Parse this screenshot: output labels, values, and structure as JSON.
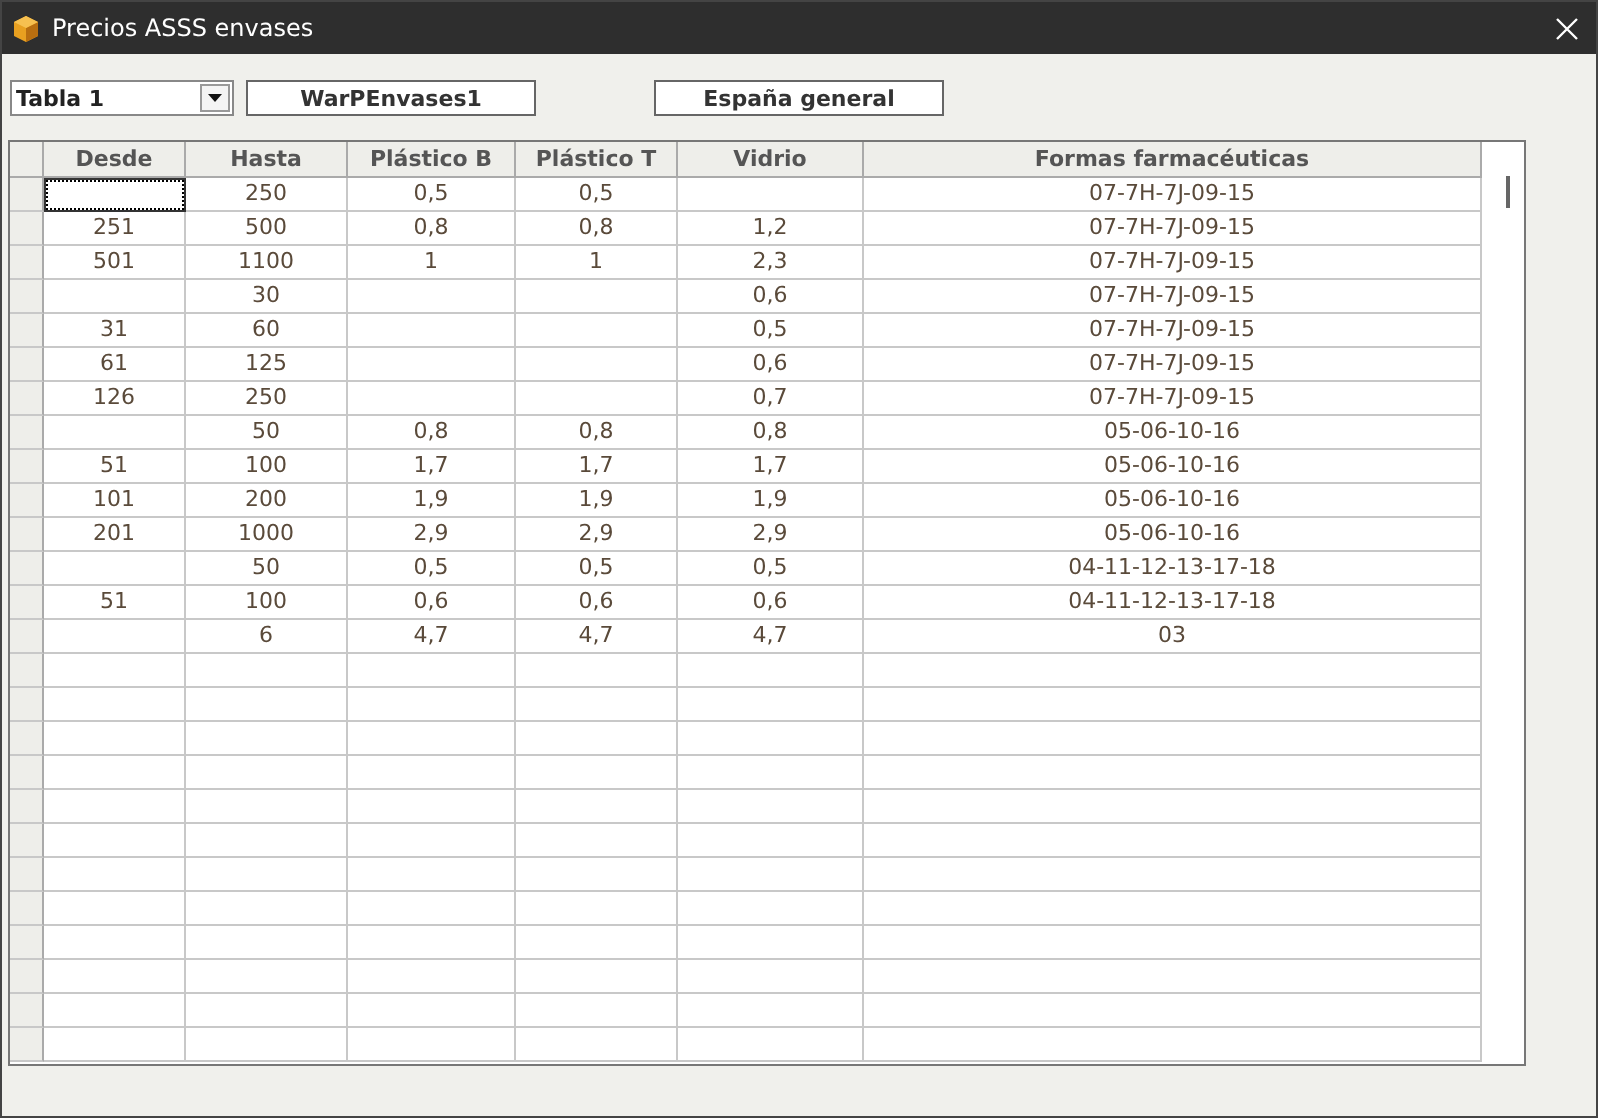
{
  "window": {
    "title": "Precios ASSS envases"
  },
  "toolbar": {
    "table_select": {
      "value": "Tabla 1"
    },
    "name_box": "WarPEnvases1",
    "region_box": "España general"
  },
  "table": {
    "columns": [
      "Desde",
      "Hasta",
      "Plástico B",
      "Plástico T",
      "Vidrio",
      "Formas farmacéuticas"
    ],
    "rows": [
      {
        "focused": true,
        "hasta": "250",
        "plastico_b": "0,5",
        "plastico_t": "0,5",
        "formas": "07-7H-7J-09-15"
      },
      {
        "focused": false,
        "desde": "251",
        "hasta": "500",
        "plastico_b": "0,8",
        "plastico_t": "0,8",
        "vidrio": "1,2",
        "formas": "07-7H-7J-09-15"
      },
      {
        "focused": false,
        "desde": "501",
        "hasta": "1100",
        "plastico_b": "1",
        "plastico_t": "1",
        "vidrio": "2,3",
        "formas": "07-7H-7J-09-15"
      },
      {
        "focused": false,
        "hasta": "30",
        "vidrio": "0,6",
        "formas": "07-7H-7J-09-15"
      },
      {
        "focused": false,
        "desde": "31",
        "hasta": "60",
        "vidrio": "0,5",
        "formas": "07-7H-7J-09-15"
      },
      {
        "focused": false,
        "desde": "61",
        "hasta": "125",
        "vidrio": "0,6",
        "formas": "07-7H-7J-09-15"
      },
      {
        "focused": false,
        "desde": "126",
        "hasta": "250",
        "vidrio": "0,7",
        "formas": "07-7H-7J-09-15"
      },
      {
        "focused": false,
        "hasta": "50",
        "plastico_b": "0,8",
        "plastico_t": "0,8",
        "vidrio": "0,8",
        "formas": "05-06-10-16"
      },
      {
        "focused": false,
        "desde": "51",
        "hasta": "100",
        "plastico_b": "1,7",
        "plastico_t": "1,7",
        "vidrio": "1,7",
        "formas": "05-06-10-16"
      },
      {
        "focused": false,
        "desde": "101",
        "hasta": "200",
        "plastico_b": "1,9",
        "plastico_t": "1,9",
        "vidrio": "1,9",
        "formas": "05-06-10-16"
      },
      {
        "focused": false,
        "desde": "201",
        "hasta": "1000",
        "plastico_b": "2,9",
        "plastico_t": "2,9",
        "vidrio": "2,9",
        "formas": "05-06-10-16"
      },
      {
        "focused": false,
        "hasta": "50",
        "plastico_b": "0,5",
        "plastico_t": "0,5",
        "vidrio": "0,5",
        "formas": "04-11-12-13-17-18"
      },
      {
        "focused": false,
        "desde": "51",
        "hasta": "100",
        "plastico_b": "0,6",
        "plastico_t": "0,6",
        "vidrio": "0,6",
        "formas": "04-11-12-13-17-18"
      },
      {
        "focused": false,
        "hasta": "6",
        "plastico_b": "4,7",
        "plastico_t": "4,7",
        "vidrio": "4,7",
        "formas": "03"
      }
    ]
  }
}
